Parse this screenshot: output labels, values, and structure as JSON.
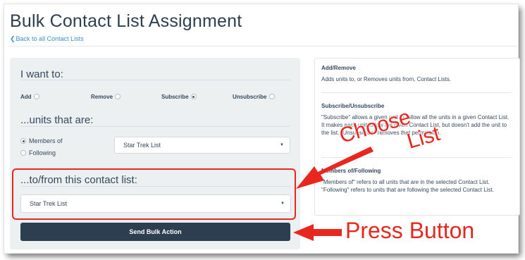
{
  "header": {
    "title": "Bulk Contact List Assignment",
    "back_link": "Back to all Contact Lists"
  },
  "form": {
    "i_want_to": {
      "heading": "I want to:",
      "options": [
        {
          "label": "Add",
          "selected": false
        },
        {
          "label": "Remove",
          "selected": false
        },
        {
          "label": "Subscribe",
          "selected": true
        },
        {
          "label": "Unsubscribe",
          "selected": false
        }
      ]
    },
    "units_that_are": {
      "heading": "...units that are:",
      "options": [
        {
          "label": "Members of",
          "selected": true
        },
        {
          "label": "Following",
          "selected": false
        }
      ],
      "select_value": "Star Trek List"
    },
    "contact_list": {
      "heading": "...to/from this contact list:",
      "select_value": "Star Trek List"
    },
    "submit_label": "Send Bulk Action"
  },
  "help": {
    "sections": [
      {
        "title": "Add/Remove",
        "text": "Adds units to, or Removes units from, Contact Lists."
      },
      {
        "title": "Subscribe/Unsubscribe",
        "text": "\"Subscribe\" allows a given unit to follow all the units in a given Contact List. It makes each unit follow the given Contact List, but doesn't add the unit to the list. \"Unsubscribe\" removes that permission."
      },
      {
        "title": "Members of/Following",
        "text": "\"Members of\" refers to all units that are in the selected Contact List. \"Following\" refers to units that are following the selected Contact List."
      }
    ]
  },
  "annotations": {
    "choose_line1": "Choose",
    "choose_line2": "List",
    "press_button": "Press Button",
    "color": "#e8281f"
  },
  "icons": {
    "back": "chevron-left-icon",
    "select_caret": "caret-down-icon"
  }
}
